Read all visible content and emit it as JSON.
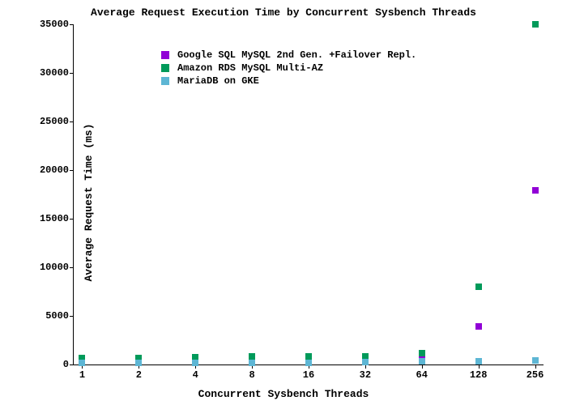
{
  "chart_data": {
    "type": "scatter",
    "title": "Average Request Execution Time by Concurrent Sysbench Threads",
    "xlabel": "Concurrent Sysbench Threads",
    "ylabel": "Average Request Time (ms)",
    "ylim": [
      0,
      35000
    ],
    "yticks": [
      0,
      5000,
      10000,
      15000,
      20000,
      25000,
      30000,
      35000
    ],
    "categories": [
      "1",
      "2",
      "4",
      "8",
      "16",
      "32",
      "64",
      "128",
      "256"
    ],
    "series": [
      {
        "name": "Google SQL MySQL 2nd Gen. +Failover Repl.",
        "color": "#9100d6",
        "values": [
          300,
          400,
          500,
          550,
          600,
          700,
          1000,
          3900,
          17900
        ]
      },
      {
        "name": "Amazon RDS MySQL Multi-AZ",
        "color": "#009a5a",
        "values": [
          700,
          700,
          750,
          800,
          800,
          850,
          1200,
          8000,
          35000
        ]
      },
      {
        "name": "MariaDB on GKE",
        "color": "#5db6d4",
        "values": [
          150,
          150,
          150,
          180,
          200,
          250,
          300,
          350,
          400
        ]
      }
    ]
  }
}
